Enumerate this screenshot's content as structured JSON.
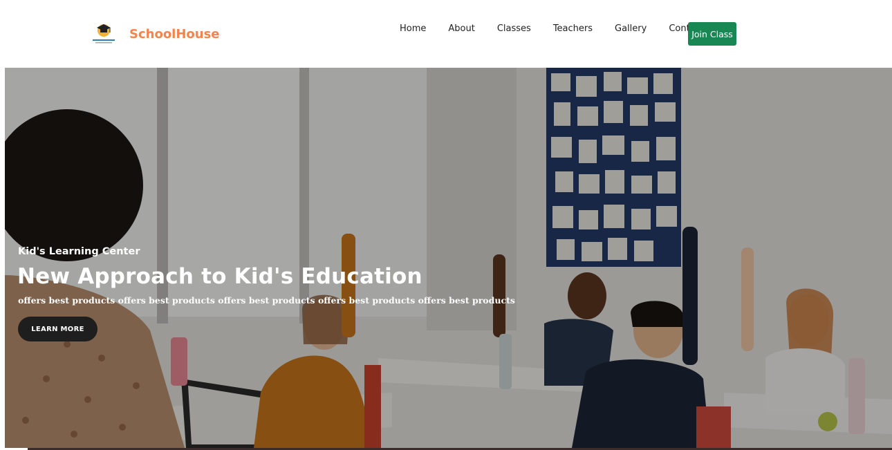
{
  "navbar": {
    "brand_name": "SchoolHouse",
    "logo_icon": "graduation-cap-lamp-icon",
    "links": [
      "Home",
      "About",
      "Classes",
      "Teachers",
      "Gallery",
      "Contact"
    ],
    "cta_label": "Join Class"
  },
  "hero": {
    "subtitle": "Kid's Learning Center",
    "title": "New Approach to Kid's Education",
    "description": "offers best products offers best products offers best products offers best products offers best products",
    "button_label": "LEARN MORE"
  },
  "colors": {
    "brand": "#f5844c",
    "cta": "#198754",
    "button_dark": "#1e1e1e"
  }
}
